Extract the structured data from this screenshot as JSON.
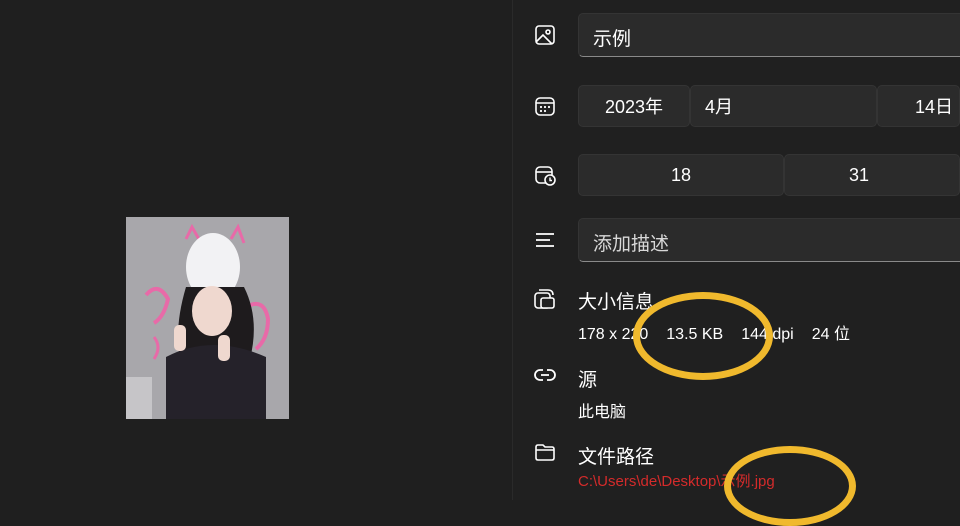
{
  "title_field": {
    "value": "示例"
  },
  "date": {
    "year": "2023年",
    "month": "4月",
    "day": "14日"
  },
  "time": {
    "hour": "18",
    "minute": "31"
  },
  "description": {
    "placeholder": "添加描述"
  },
  "size_info": {
    "title": "大小信息",
    "dimensions": "178 x 220",
    "file_size": "13.5 KB",
    "dpi": "144 dpi",
    "bit_depth": "24 位"
  },
  "source": {
    "title": "源",
    "value": "此电脑"
  },
  "file_path": {
    "title": "文件路径",
    "value": "C:\\Users\\de\\Desktop\\示例.jpg"
  },
  "colors": {
    "background": "#1f1f1f",
    "field": "#2b2b2b",
    "annotation": "#f0b92d",
    "path_link": "#d42b2b"
  },
  "icons": [
    "image-icon",
    "calendar-icon",
    "clock-calendar-icon",
    "description-lines-icon",
    "size-info-icon",
    "link-icon",
    "folder-icon"
  ]
}
